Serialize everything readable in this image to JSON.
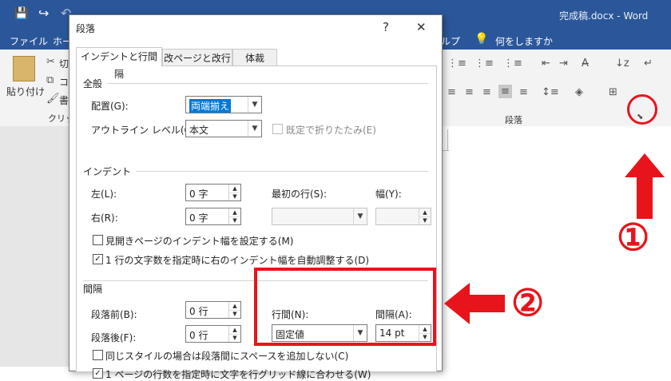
{
  "word": {
    "filename": "完成稿.docx",
    "app_name": "Word",
    "tabs": [
      "ファイル",
      "ホー",
      "ルプ"
    ],
    "tell_me": "何をしますか",
    "clipboard": {
      "paste_label": "貼り付け",
      "cut_partial": "切",
      "copy_partial": "コピ",
      "format_partial": "書",
      "group_partial": "クリップ"
    },
    "paragraph_group_label": "段落"
  },
  "dialog": {
    "title": "段落",
    "help": "?",
    "close": "✕",
    "tabs": [
      "インデントと行間隔",
      "改ページと改行",
      "体裁"
    ],
    "general": {
      "header": "全般",
      "alignment_label": "配置(G):",
      "alignment_value": "両端揃え",
      "outline_label": "アウトライン レベル(O):",
      "outline_value": "本文",
      "collapse_label": "既定で折りたたみ(E)"
    },
    "indent": {
      "header": "インデント",
      "left_label": "左(L):",
      "left_value": "0 字",
      "right_label": "右(R):",
      "right_value": "0 字",
      "first_line_label": "最初の行(S):",
      "first_line_value": "",
      "width_label": "幅(Y):",
      "width_value": "",
      "mirror_label": "見開きページのインデント幅を設定する(M)",
      "mirror_checked": false,
      "auto_adjust_label": "1 行の文字数を指定時に右のインデント幅を自動調整する(D)",
      "auto_adjust_checked": true
    },
    "spacing": {
      "header": "間隔",
      "before_label": "段落前(B):",
      "before_value": "0 行",
      "after_label": "段落後(F):",
      "after_value": "0 行",
      "line_spacing_label": "行間(N):",
      "line_spacing_value": "固定値",
      "at_label": "間隔(A):",
      "at_value": "14 pt",
      "no_space_same_style_label": "同じスタイルの場合は段落間にスペースを追加しない(C)",
      "no_space_same_style_checked": false,
      "snap_grid_label": "1 ページの行数を指定時に文字を行グリッド線に合わせる(W)",
      "snap_grid_checked": true
    }
  },
  "annotations": {
    "marker_1": "①",
    "marker_2": "②",
    "color": "#e8141b"
  },
  "colors": {
    "word_blue": "#2b579a",
    "selection_blue": "#0078d7"
  }
}
